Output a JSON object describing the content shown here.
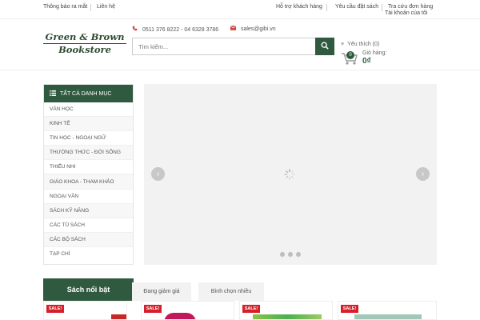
{
  "topbar": {
    "new_releases": "Thông báo ra mắt",
    "contact": "Liên hệ",
    "customer_support": "Hỗ trợ khách hàng",
    "order_request": "Yêu cầu đặt sách",
    "order_lookup": "Tra cứu đơn hàng",
    "my_account": "Tài khoản của tôi"
  },
  "logo": {
    "line1": "Green & Brown",
    "line2": "Bookstore"
  },
  "contact": {
    "phone": "0511 376 8222 - 04 6328 3786",
    "email": "sales@gibi.vn"
  },
  "search": {
    "placeholder": "Tìm kiếm..."
  },
  "wishlist": {
    "label": "Yêu thích (0)"
  },
  "cart": {
    "count": "0",
    "label": "Giỏ hàng:",
    "amount": "0₫"
  },
  "sidebar": {
    "title": "TẤT CẢ DANH MỤC",
    "items": [
      "VĂN HỌC",
      "KINH TẾ",
      "TIN HỌC - NGOẠI NGỮ",
      "THƯỜNG THỨC - ĐỜI SỐNG",
      "THIẾU NHI",
      "GIÁO KHOA - THAM KHẢO",
      "NGOẠI VĂN",
      "SÁCH KỸ NĂNG",
      "CÁC TỦ SÁCH",
      "CÁC BỘ SÁCH",
      "TẠP CHÍ"
    ]
  },
  "featured": {
    "title": "Sách nổi bật"
  },
  "tabs": [
    "Đang giảm giá",
    "Bình chọn nhiều"
  ],
  "products": [
    {
      "badge": "SALE!"
    },
    {
      "badge": "SALE!"
    },
    {
      "badge": "SALE!"
    },
    {
      "badge": "SALE!"
    }
  ],
  "colors": {
    "brand_green": "#2f5a3f",
    "sale_red": "#d71f2a",
    "accent_red": "#d43e3e"
  },
  "icons": {
    "phone": "phone-icon",
    "email": "email-icon",
    "search": "search-icon",
    "wishlist": "heart-icon",
    "cart": "cart-icon",
    "menu": "menu-list-icon",
    "prev": "chevron-left-icon",
    "next": "chevron-right-icon",
    "loading": "loading-spinner-icon"
  }
}
